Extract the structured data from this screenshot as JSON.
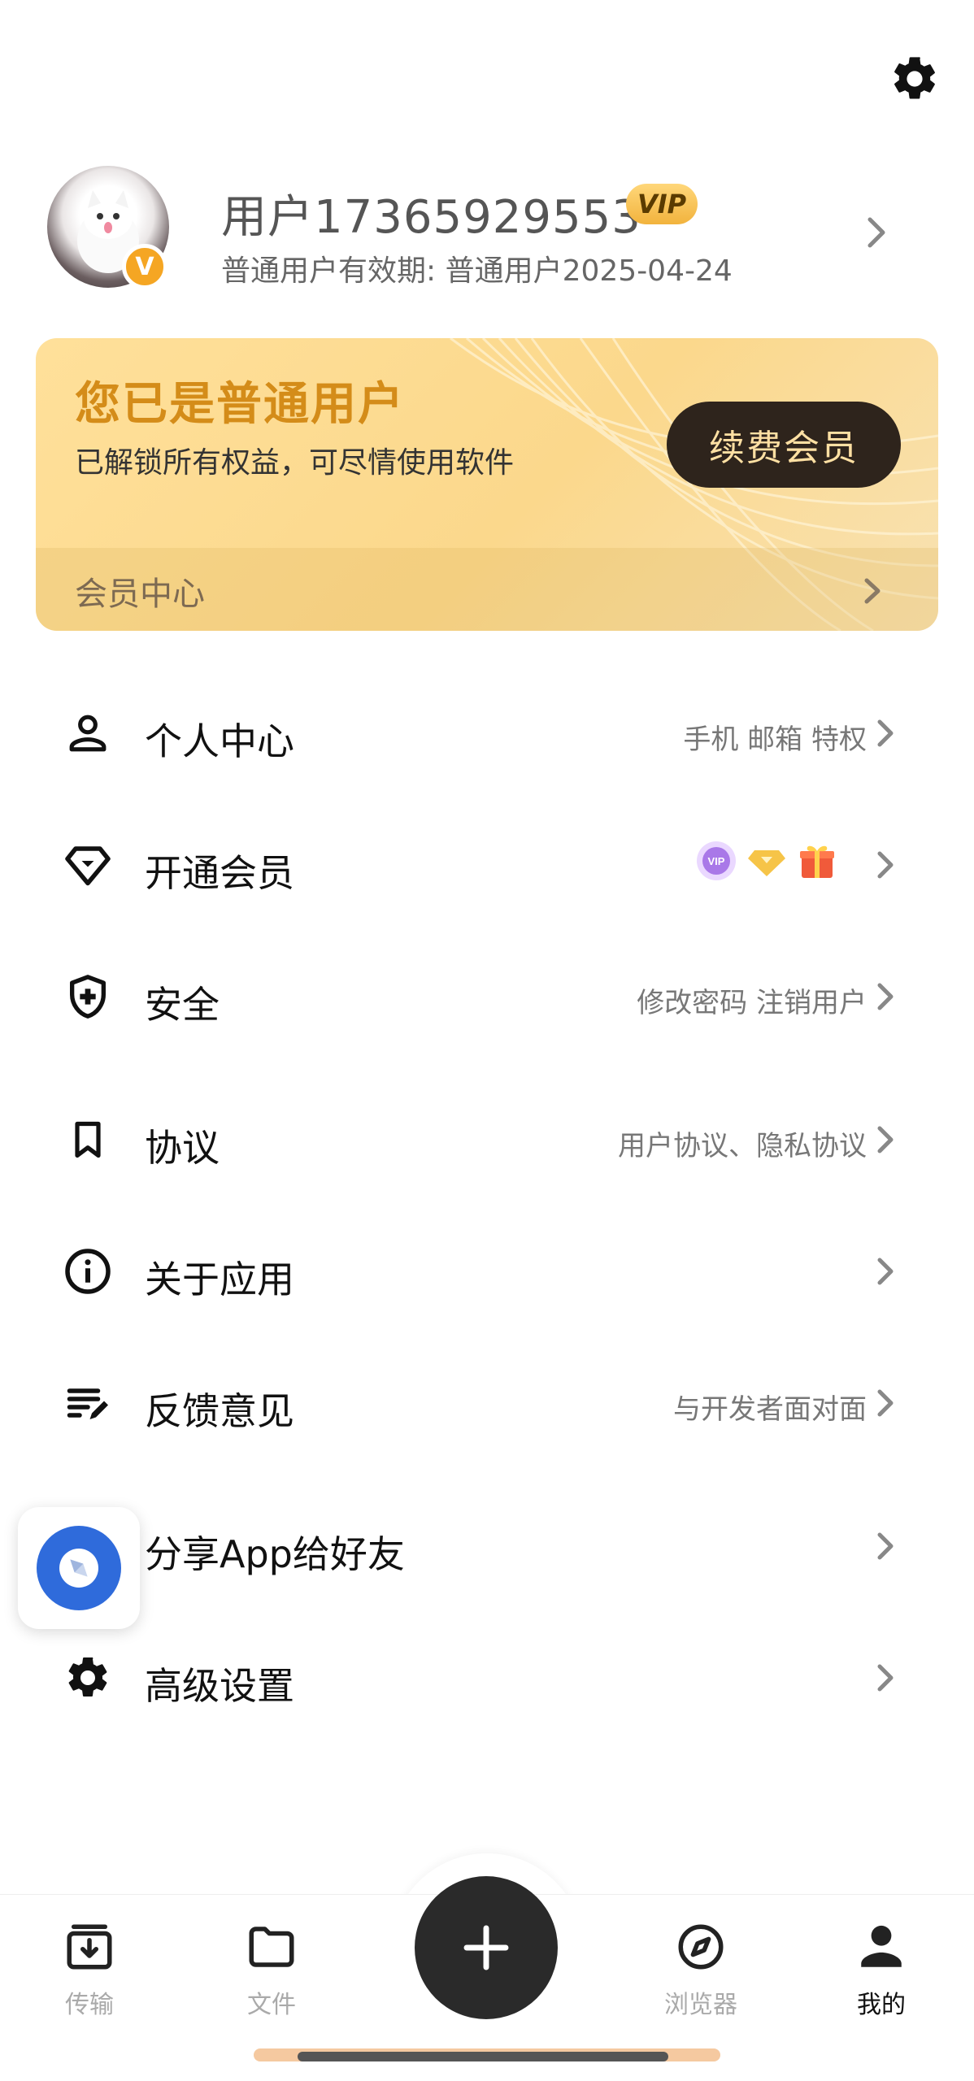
{
  "header": {
    "settings_icon": "gear-icon"
  },
  "profile": {
    "username": "用户17365929553",
    "vip_badge": "VIP",
    "validity": "普通用户有效期:  普通用户2025-04-24",
    "verified_mark": "V"
  },
  "vip_card": {
    "title": "您已是普通用户",
    "subtitle": "已解锁所有权益，可尽情使用软件",
    "renew_label": "续费会员",
    "center_label": "会员中心",
    "accent_color": "#d48c19",
    "button_color": "#2e241c"
  },
  "menu": {
    "items": [
      {
        "label": "个人中心",
        "extra": "手机 邮箱 特权",
        "icon": "person-icon"
      },
      {
        "label": "开通会员",
        "extra": "",
        "icon": "diamond-icon"
      },
      {
        "label": "安全",
        "extra": "修改密码  注销用户",
        "icon": "shield-icon"
      },
      {
        "label": "协议",
        "extra": "用户协议、隐私协议",
        "icon": "bookmark-icon"
      },
      {
        "label": "关于应用",
        "extra": "",
        "icon": "info-icon"
      },
      {
        "label": "反馈意见",
        "extra": "与开发者面对面",
        "icon": "edit-list-icon"
      },
      {
        "label": "分享App给好友",
        "extra": "",
        "icon": "share-icon"
      },
      {
        "label": "高级设置",
        "extra": "",
        "icon": "gear-icon"
      }
    ],
    "member_badges": [
      "vip-badge-icon",
      "diamond-badge-icon",
      "gift-icon"
    ]
  },
  "tabbar": {
    "tabs": [
      {
        "label": "传输",
        "icon": "download-box-icon",
        "active": false
      },
      {
        "label": "文件",
        "icon": "folder-icon",
        "active": false
      },
      {
        "label": "浏览器",
        "icon": "compass-icon",
        "active": false
      },
      {
        "label": "我的",
        "icon": "person-icon",
        "active": true
      }
    ],
    "fab_icon": "plus-icon"
  }
}
